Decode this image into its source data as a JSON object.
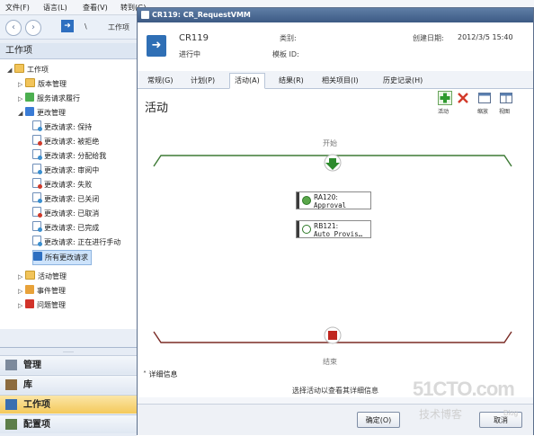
{
  "menu": {
    "file": "文件(F)",
    "language": "语言(L)",
    "view": "查看(V)",
    "goto": "转到(G)"
  },
  "nav": {
    "path_sep": "\\",
    "path": "工作项"
  },
  "left_pane": {
    "title": "工作项",
    "tree": [
      {
        "label": "工作项"
      },
      {
        "label": "版本管理"
      },
      {
        "label": "服务请求履行"
      },
      {
        "label": "更改管理"
      },
      {
        "label": "更改请求: 保持"
      },
      {
        "label": "更改请求: 被拒绝"
      },
      {
        "label": "更改请求: 分配给我"
      },
      {
        "label": "更改请求: 审阅中"
      },
      {
        "label": "更改请求: 失败"
      },
      {
        "label": "更改请求: 已关闭"
      },
      {
        "label": "更改请求: 已取消"
      },
      {
        "label": "更改请求: 已完成"
      },
      {
        "label": "更改请求: 正在进行手动"
      },
      {
        "label": "所有更改请求"
      },
      {
        "label": "活动管理"
      },
      {
        "label": "事件管理"
      },
      {
        "label": "问题管理"
      }
    ],
    "wunderbar": {
      "grip": "……",
      "admin": "管理",
      "library": "库",
      "workitems": "工作项",
      "more": "配置项"
    }
  },
  "form": {
    "title": "CR119: CR_RequestVMM",
    "header": {
      "id": "CR119",
      "status": "进行中",
      "category_label": "类别:",
      "template_label": "模板 ID:",
      "created_label": "创建日期:",
      "created_value": "2012/3/5 15:40"
    },
    "tabs": [
      "常规(G)",
      "计划(P)",
      "活动(A)",
      "结果(R)",
      "相关项目(I)",
      "历史记录(H)"
    ],
    "content_title": "活动",
    "toolbar": {
      "activity": "活动",
      "zoom": "缩放",
      "view": "视图"
    },
    "flow": {
      "start": "开始",
      "end": "结束",
      "activities": [
        {
          "id": "RA120:",
          "name": "Approval"
        },
        {
          "id": "RB121:",
          "name": "Auto Provis…"
        }
      ]
    },
    "details_label": "详细信息",
    "details_hint": "选择活动以查看其详细信息",
    "footer": {
      "ok": "确定(O)",
      "cancel": "取消"
    }
  },
  "watermark": {
    "site": "51CTO.com",
    "slogan": "技术博客",
    "blog": "Blog"
  },
  "colors": {
    "flow_line": "#3d7a35",
    "end_line": "#7a2b25",
    "start_arrow": "#2e8b2e",
    "end_square": "#c0261f"
  }
}
